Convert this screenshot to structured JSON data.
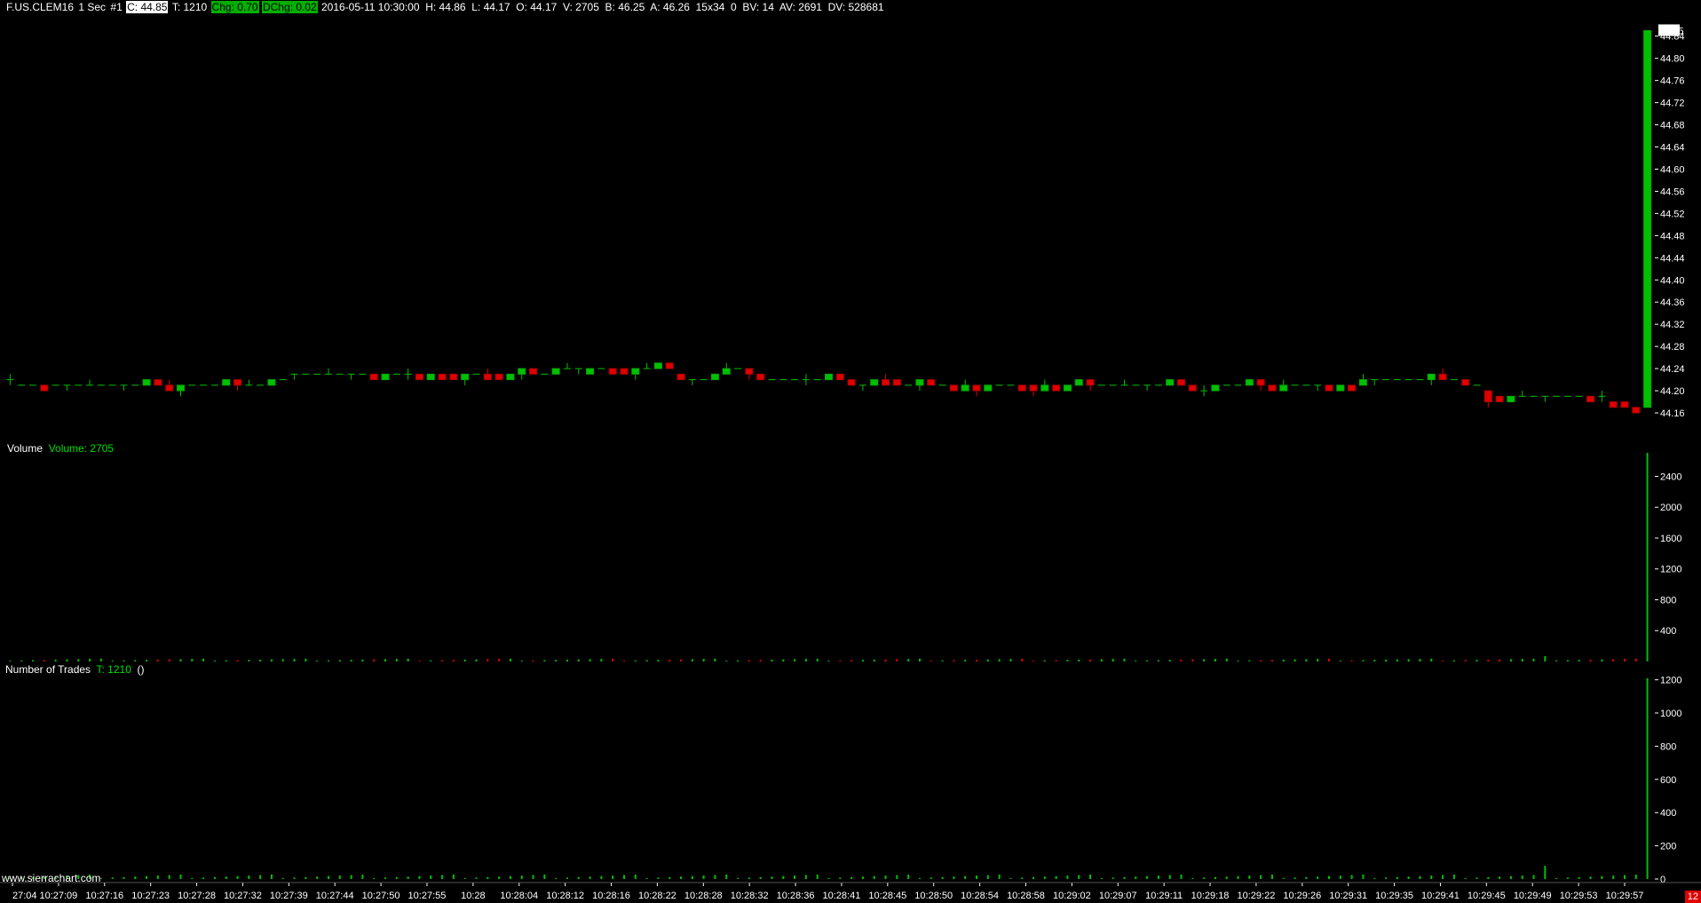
{
  "header": {
    "symbol": "F.US.CLEM16",
    "interval": "1 Sec",
    "chart_number": "#1",
    "close": "C: 44.85",
    "trades": "T: 1210",
    "change": "Chg: 0.70",
    "dchange": "DChg: 0.02",
    "rest": "2016-05-11 10:30:00  H: 44.86  L: 44.17  O: 44.17  V: 2705  B: 46.25  A: 46.26  15x34  0  BV: 14  AV: 2691  DV: 528681"
  },
  "volume_panel": {
    "name": "Volume",
    "value_label": "Volume: 2705"
  },
  "trades_panel": {
    "name": "Number of Trades",
    "value_label": "T: 1210",
    "extra": "()"
  },
  "footer": {
    "url": "www.sierrachart.com",
    "badge": "12"
  },
  "colors": {
    "up": "#00c000",
    "down": "#e00000",
    "background": "#000000",
    "text": "#ffffff"
  },
  "chart_data": [
    {
      "type": "candlestick",
      "title": "F.US.CLEM16 1 Sec",
      "ylim": [
        44.12,
        44.87
      ],
      "y_ticks": [
        "44.16",
        "44.20",
        "44.24",
        "44.28",
        "44.32",
        "44.36",
        "44.40",
        "44.44",
        "44.48",
        "44.52",
        "44.56",
        "44.60",
        "44.64",
        "44.68",
        "44.72",
        "44.76",
        "44.80",
        "44.84"
      ],
      "current_price_label": "44.85",
      "x_ticks": [
        "27:04",
        "10:27:09",
        "10:27:16",
        "10:27:23",
        "10:27:28",
        "10:27:32",
        "10:27:39",
        "10:27:44",
        "10:27:50",
        "10:27:55",
        "10:28",
        "10:28:04",
        "10:28:12",
        "10:28:16",
        "10:28:22",
        "10:28:28",
        "10:28:32",
        "10:28:36",
        "10:28:41",
        "10:28:45",
        "10:28:50",
        "10:28:54",
        "10:28:58",
        "10:29:02",
        "10:29:07",
        "10:29:11",
        "10:29:18",
        "10:29:22",
        "10:29:26",
        "10:29:31",
        "10:29:35",
        "10:29:41",
        "10:29:45",
        "10:29:49",
        "10:29:53",
        "10:29:57"
      ],
      "closes": [
        44.22,
        44.21,
        44.21,
        44.2,
        44.21,
        44.21,
        44.21,
        44.21,
        44.21,
        44.21,
        44.21,
        44.21,
        44.22,
        44.21,
        44.2,
        44.21,
        44.21,
        44.21,
        44.21,
        44.22,
        44.21,
        44.21,
        44.21,
        44.22,
        44.22,
        44.23,
        44.23,
        44.23,
        44.23,
        44.23,
        44.23,
        44.23,
        44.22,
        44.23,
        44.23,
        44.23,
        44.22,
        44.23,
        44.22,
        44.22,
        44.23,
        44.23,
        44.22,
        44.22,
        44.23,
        44.24,
        44.23,
        44.23,
        44.24,
        44.24,
        44.24,
        44.24,
        44.24,
        44.23,
        44.23,
        44.24,
        44.24,
        44.25,
        44.24,
        44.22,
        44.22,
        44.22,
        44.23,
        44.24,
        44.24,
        44.23,
        44.22,
        44.22,
        44.22,
        44.22,
        44.22,
        44.22,
        44.23,
        44.22,
        44.21,
        44.21,
        44.22,
        44.21,
        44.21,
        44.21,
        44.22,
        44.21,
        44.21,
        44.2,
        44.21,
        44.2,
        44.21,
        44.21,
        44.21,
        44.2,
        44.2,
        44.21,
        44.2,
        44.21,
        44.22,
        44.21,
        44.21,
        44.21,
        44.21,
        44.21,
        44.21,
        44.21,
        44.22,
        44.21,
        44.2,
        44.2,
        44.21,
        44.21,
        44.21,
        44.22,
        44.21,
        44.2,
        44.21,
        44.21,
        44.21,
        44.21,
        44.2,
        44.21,
        44.2,
        44.22,
        44.22,
        44.22,
        44.22,
        44.22,
        44.22,
        44.23,
        44.22,
        44.22,
        44.21,
        44.21,
        44.18,
        44.18,
        44.19,
        44.19,
        44.19,
        44.19,
        44.19,
        44.19,
        44.19,
        44.18,
        44.19,
        44.17,
        44.17,
        44.16,
        44.85
      ],
      "opens": [
        44.22,
        44.21,
        44.21,
        44.21,
        44.21,
        44.21,
        44.21,
        44.21,
        44.21,
        44.21,
        44.21,
        44.21,
        44.21,
        44.22,
        44.21,
        44.2,
        44.21,
        44.21,
        44.21,
        44.21,
        44.22,
        44.21,
        44.21,
        44.21,
        44.22,
        44.23,
        44.23,
        44.23,
        44.23,
        44.23,
        44.23,
        44.23,
        44.23,
        44.22,
        44.23,
        44.23,
        44.23,
        44.22,
        44.23,
        44.23,
        44.22,
        44.23,
        44.23,
        44.23,
        44.22,
        44.23,
        44.24,
        44.23,
        44.23,
        44.24,
        44.24,
        44.23,
        44.24,
        44.24,
        44.24,
        44.23,
        44.24,
        44.24,
        44.25,
        44.23,
        44.22,
        44.22,
        44.22,
        44.23,
        44.24,
        44.24,
        44.23,
        44.22,
        44.22,
        44.22,
        44.22,
        44.22,
        44.22,
        44.23,
        44.22,
        44.21,
        44.21,
        44.22,
        44.22,
        44.21,
        44.21,
        44.22,
        44.21,
        44.21,
        44.2,
        44.21,
        44.2,
        44.21,
        44.21,
        44.21,
        44.21,
        44.2,
        44.21,
        44.2,
        44.21,
        44.22,
        44.21,
        44.21,
        44.21,
        44.21,
        44.21,
        44.21,
        44.21,
        44.22,
        44.21,
        44.2,
        44.2,
        44.21,
        44.21,
        44.21,
        44.22,
        44.21,
        44.2,
        44.21,
        44.21,
        44.21,
        44.21,
        44.2,
        44.21,
        44.21,
        44.22,
        44.22,
        44.22,
        44.22,
        44.22,
        44.22,
        44.23,
        44.22,
        44.22,
        44.21,
        44.2,
        44.19,
        44.18,
        44.19,
        44.19,
        44.19,
        44.19,
        44.19,
        44.19,
        44.19,
        44.19,
        44.18,
        44.18,
        44.17,
        44.17
      ]
    },
    {
      "type": "bar",
      "title": "Volume",
      "ylim": [
        0,
        2705
      ],
      "y_ticks": [
        "400",
        "800",
        "1200",
        "1600",
        "2000",
        "2400"
      ],
      "last_value": 2705
    },
    {
      "type": "bar",
      "title": "Number of Trades",
      "ylim": [
        0,
        1230
      ],
      "y_ticks": [
        "0",
        "200",
        "400",
        "600",
        "800",
        "1000",
        "1200"
      ],
      "last_value": 1210
    }
  ]
}
